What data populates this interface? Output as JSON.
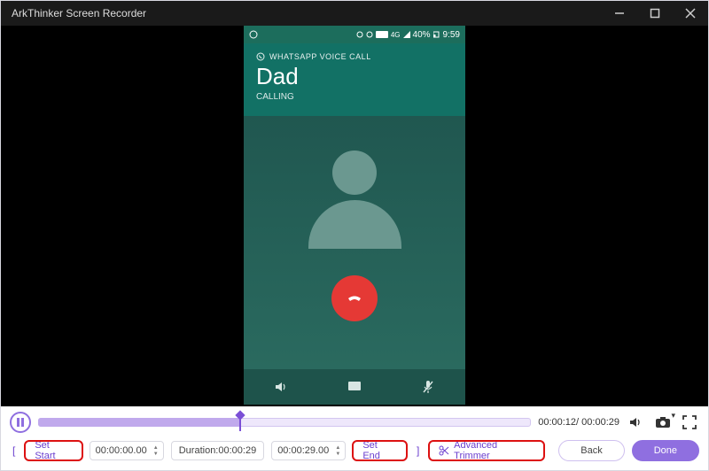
{
  "window": {
    "title": "ArkThinker Screen Recorder"
  },
  "phone": {
    "statusbar": {
      "battery": "40%",
      "time": "9:59"
    },
    "call": {
      "type_label": "WHATSAPP VOICE CALL",
      "name": "Dad",
      "status": "CALLING"
    }
  },
  "playback": {
    "current": "00:00:12",
    "total": "00:00:29"
  },
  "trim": {
    "set_start_label": "Set Start",
    "start_time": "00:00:00.00",
    "duration_label": "Duration:00:00:29",
    "end_time": "00:00:29.00",
    "set_end_label": "Set End",
    "advanced_label": "Advanced Trimmer"
  },
  "buttons": {
    "back": "Back",
    "done": "Done"
  },
  "icons": {
    "minimize": "minimize",
    "maximize": "maximize",
    "close": "close",
    "pause": "pause",
    "volume": "volume",
    "snapshot": "snapshot",
    "fullscreen": "fullscreen",
    "scissors": "scissors",
    "speaker": "speaker",
    "chat": "chat",
    "micmute": "micmute",
    "phone": "phone",
    "whatsapp": "whatsapp"
  }
}
